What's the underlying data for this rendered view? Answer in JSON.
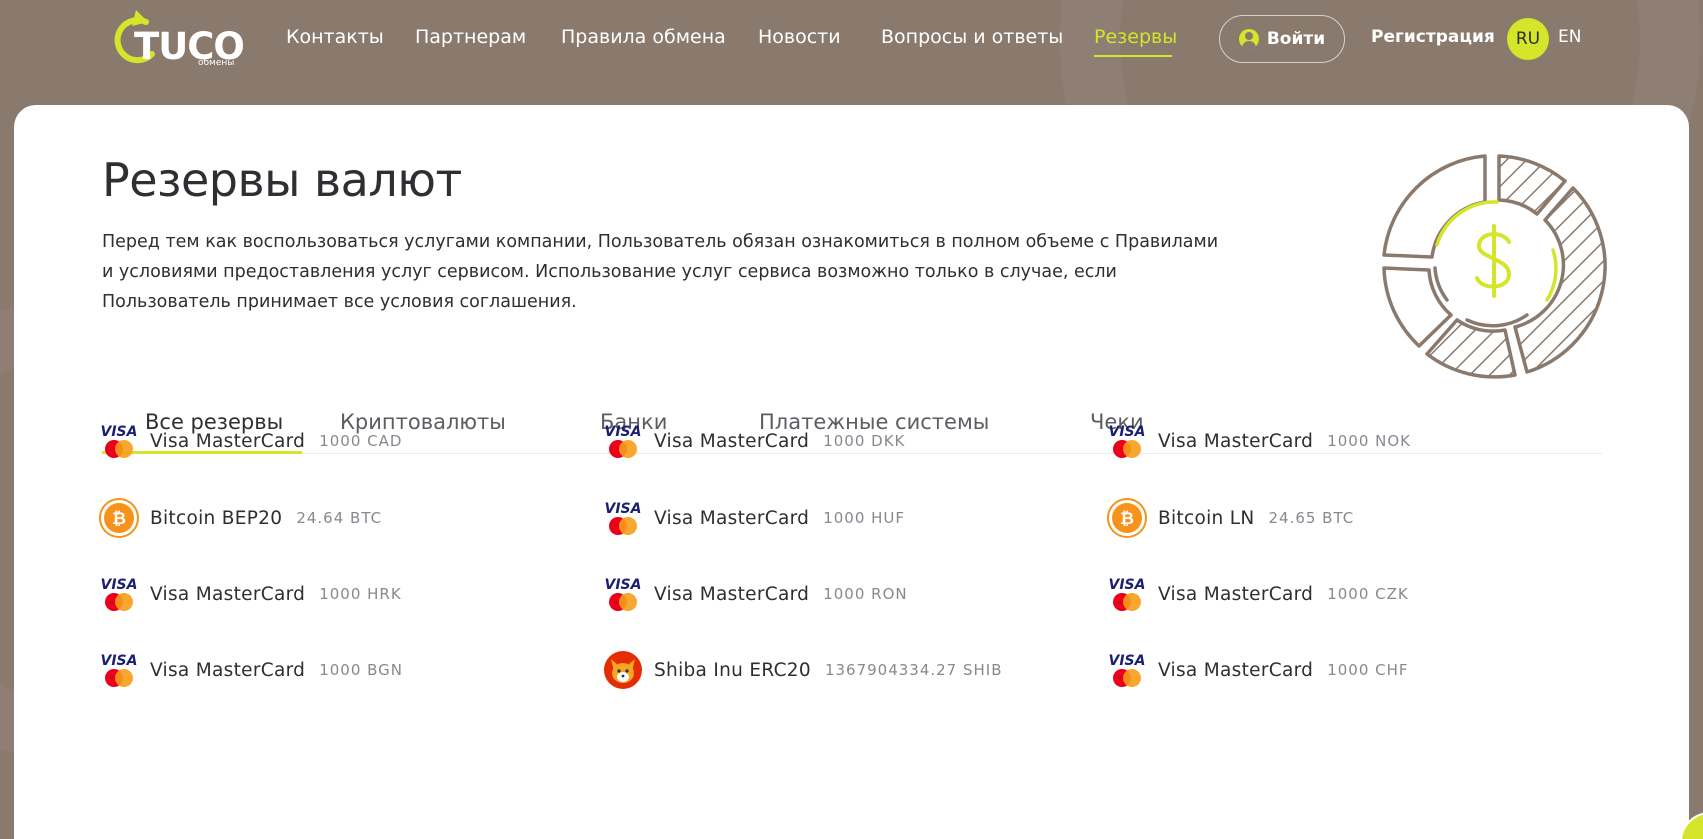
{
  "header": {
    "logo_text": "TUCO",
    "logo_sub": "обмены",
    "nav": [
      {
        "label": "Контакты"
      },
      {
        "label": "Партнерам"
      },
      {
        "label": "Правила обмена"
      },
      {
        "label": "Новости"
      },
      {
        "label": "Вопросы и ответы"
      },
      {
        "label": "Резервы",
        "active": true
      }
    ],
    "login_label": "Войти",
    "register_label": "Регистрация",
    "lang_ru": "RU",
    "lang_en": "EN"
  },
  "main": {
    "title": "Резервы валют",
    "intro": "Перед тем как воспользоваться услугами компании, Пользователь обязан ознакомиться в полном объеме с Правилами и условиями предоставления услуг сервисом. Использование услуг сервиса возможно только в случае, если Пользователь принимает все условия соглашения.",
    "tabs": [
      {
        "label": "Все резервы",
        "active": true
      },
      {
        "label": "Криптовалюты"
      },
      {
        "label": "Банки"
      },
      {
        "label": "Платежные системы"
      },
      {
        "label": "Чеки"
      }
    ],
    "reserves": [
      [
        {
          "name": "Visa MasterCard",
          "amount": "1000 CAD",
          "icon": "visa-mastercard-icon"
        },
        {
          "name": "Bitcoin BEP20",
          "amount": "24.64 BTC",
          "icon": "bitcoin-icon"
        },
        {
          "name": "Visa MasterCard",
          "amount": "1000 HRK",
          "icon": "visa-mastercard-icon"
        },
        {
          "name": "Visa MasterCard",
          "amount": "1000 BGN",
          "icon": "visa-mastercard-icon"
        }
      ],
      [
        {
          "name": "Visa MasterCard",
          "amount": "1000 DKK",
          "icon": "visa-mastercard-icon"
        },
        {
          "name": "Visa MasterCard",
          "amount": "1000 HUF",
          "icon": "visa-mastercard-icon"
        },
        {
          "name": "Visa MasterCard",
          "amount": "1000 RON",
          "icon": "visa-mastercard-icon"
        },
        {
          "name": "Shiba Inu ERC20",
          "amount": "1367904334.27 SHIB",
          "icon": "shiba-inu-icon"
        }
      ],
      [
        {
          "name": "Visa MasterCard",
          "amount": "1000 NOK",
          "icon": "visa-mastercard-icon"
        },
        {
          "name": "Bitcoin LN",
          "amount": "24.65 BTC",
          "icon": "bitcoin-icon"
        },
        {
          "name": "Visa MasterCard",
          "amount": "1000 CZK",
          "icon": "visa-mastercard-icon"
        },
        {
          "name": "Visa MasterCard",
          "amount": "1000 CHF",
          "icon": "visa-mastercard-icon"
        }
      ]
    ]
  },
  "colors": {
    "accent": "#d4e52a",
    "header_bg": "#8a7a6e",
    "icon_stroke": "#8a7a6e",
    "bitcoin": "#f7931a"
  }
}
